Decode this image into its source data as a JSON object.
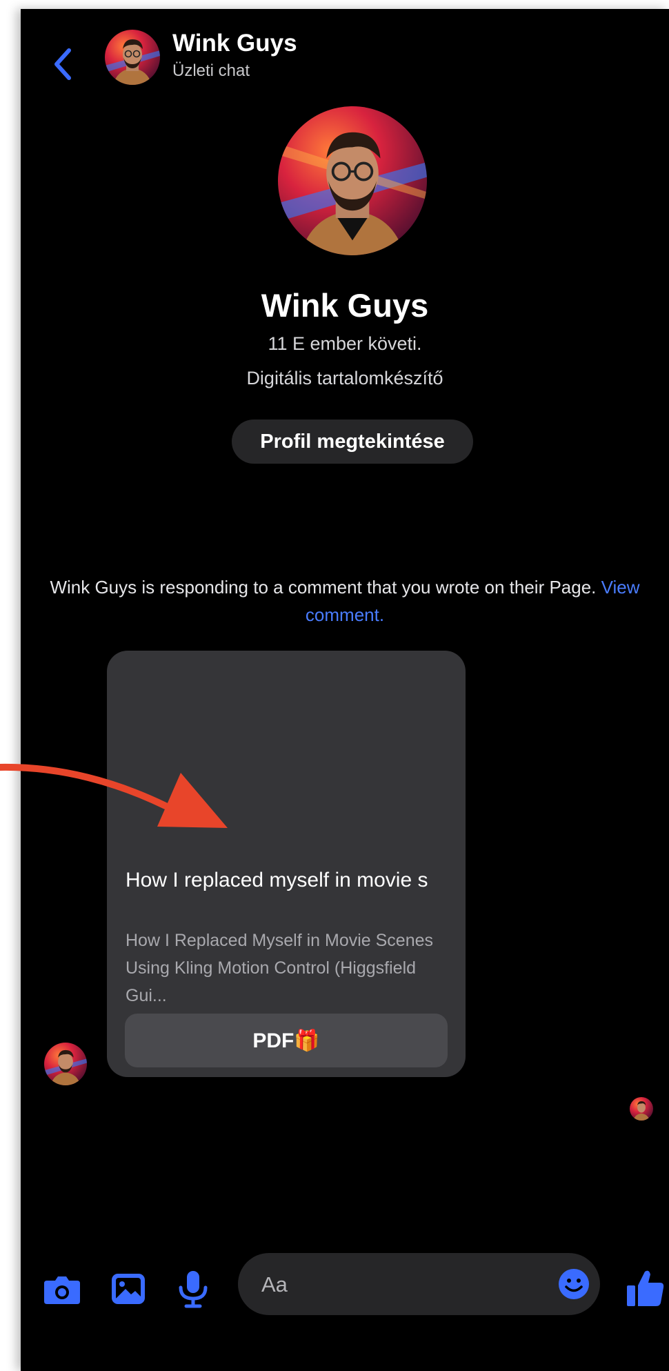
{
  "header": {
    "name": "Wink Guys",
    "subtitle": "Üzleti chat"
  },
  "profile": {
    "name": "Wink Guys",
    "followers": "11 E ember követi.",
    "category": "Digitális tartalomkészítő",
    "view_profile_label": "Profil megtekintése"
  },
  "notice": {
    "text": "Wink Guys is responding to a comment that you wrote on their Page.",
    "link_label": "View comment."
  },
  "card": {
    "title": "How I replaced myself in movie s",
    "description": "How I Replaced Myself in Movie Scenes Using Kling Motion Control (Higgsfield Gui...",
    "button_label": "PDF🎁"
  },
  "composer": {
    "placeholder": "Aa"
  },
  "icons": {
    "back": "chevron-left-icon",
    "camera": "camera-icon",
    "gallery": "image-icon",
    "mic": "microphone-icon",
    "emoji": "smiley-icon",
    "like": "thumbs-up-icon"
  },
  "colors": {
    "background": "#000000",
    "accent": "#3a6bff",
    "link": "#4a7dff",
    "bubble": "#353538",
    "annotation_arrow": "#e8452a"
  }
}
